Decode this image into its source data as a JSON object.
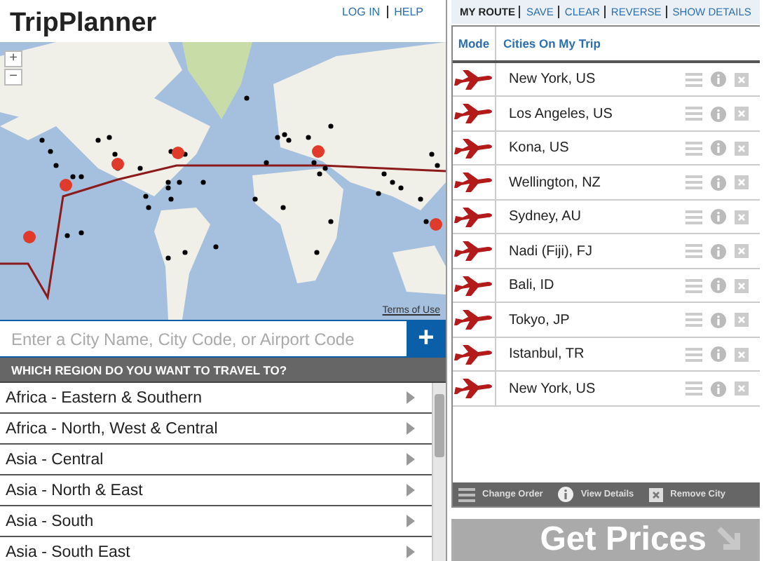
{
  "app_title": "TripPlanner",
  "header_links": [
    "LOG IN",
    "HELP"
  ],
  "map": {
    "zoom_in": "+",
    "zoom_out": "−",
    "terms": "Terms of Use"
  },
  "search": {
    "placeholder": "Enter a City Name, City Code, or Airport Code",
    "add_label": "+"
  },
  "regions": {
    "heading": "WHICH REGION DO YOU WANT TO TRAVEL TO?",
    "items": [
      {
        "label": "Africa - Eastern & Southern"
      },
      {
        "label": "Africa - North, West & Central"
      },
      {
        "label": "Asia - Central"
      },
      {
        "label": "Asia - North & East"
      },
      {
        "label": "Asia - South"
      },
      {
        "label": "Asia - South East"
      }
    ]
  },
  "route_nav": [
    {
      "label": "MY ROUTE",
      "selected": true
    },
    {
      "label": "SAVE",
      "selected": false
    },
    {
      "label": "CLEAR",
      "selected": false
    },
    {
      "label": "REVERSE",
      "selected": false
    },
    {
      "label": "SHOW DETAILS",
      "selected": false
    }
  ],
  "trip": {
    "columns": [
      "Mode",
      "Cities On My Trip"
    ],
    "rows": [
      {
        "city": "New York, US"
      },
      {
        "city": "Los Angeles, US"
      },
      {
        "city": "Kona, US"
      },
      {
        "city": "Wellington, NZ"
      },
      {
        "city": "Sydney, AU"
      },
      {
        "city": "Nadi (Fiji), FJ"
      },
      {
        "city": "Bali, ID"
      },
      {
        "city": "Tokyo, JP"
      },
      {
        "city": "Istanbul, TR"
      },
      {
        "city": "New York, US"
      }
    ]
  },
  "legend": [
    "Change Order",
    "View Details",
    "Remove City"
  ],
  "get_prices": "Get Prices"
}
